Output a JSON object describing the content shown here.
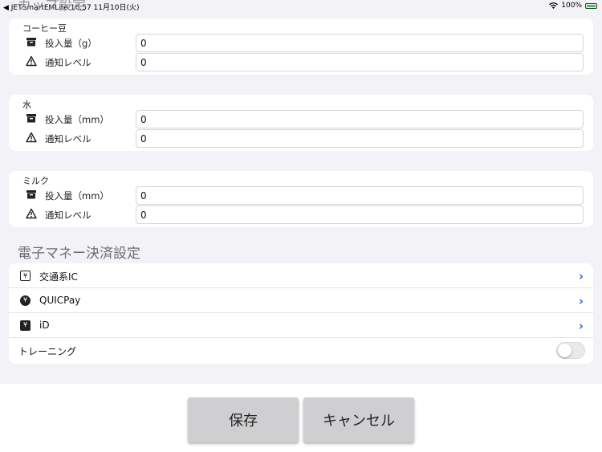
{
  "status_bar": {
    "left": "◀ JETSmartEMLite  16:57  11月10日(火)",
    "battery": "100%"
  },
  "ghost_header": "カップ設定",
  "coffee": {
    "title": "コーヒー豆",
    "amount_label": "投入量（g）",
    "amount_value": "0",
    "notify_label": "通知レベル",
    "notify_value": "0"
  },
  "water": {
    "title": "水",
    "amount_label": "投入量（mm）",
    "amount_value": "0",
    "notify_label": "通知レベル",
    "notify_value": "0"
  },
  "milk": {
    "title": "ミルク",
    "amount_label": "投入量（mm）",
    "amount_value": "0",
    "notify_label": "通知レベル",
    "notify_value": "0"
  },
  "payment": {
    "header": "電子マネー決済設定",
    "items": [
      {
        "label": "交通系IC",
        "icon": "yen-outline-icon"
      },
      {
        "label": "QUICPay",
        "icon": "yen-circle-icon"
      },
      {
        "label": "iD",
        "icon": "yen-square-icon"
      }
    ],
    "training_label": "トレーニング",
    "training_on": false
  },
  "footer": {
    "save_label": "保存",
    "cancel_label": "キャンセル"
  }
}
